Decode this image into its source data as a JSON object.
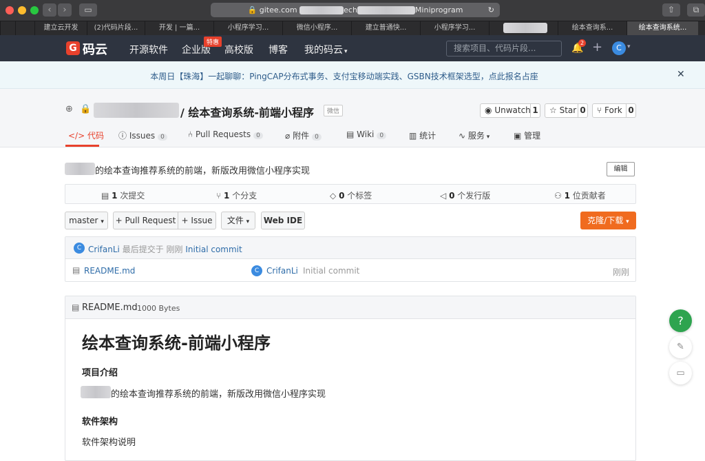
{
  "browser": {
    "url": "gitee.com",
    "url_part2": "ech",
    "url_part3": "Miniprogram",
    "tabs": [
      "建立云开发",
      "(2)代码片段...",
      "开发 | 一篇...",
      "小程序学习...",
      "微信小程序...",
      "建立普通快...",
      "小程序学习...",
      "",
      "绘本查询系...",
      "绘本查询系统..."
    ]
  },
  "header": {
    "logo_mark": "G",
    "logo_text": "码云",
    "nav": [
      "开源软件",
      "企业版",
      "高校版",
      "博客",
      "我的码云"
    ],
    "promo_badge": "特惠",
    "search_placeholder": "搜索项目、代码片段...",
    "notification_count": "2",
    "avatar_letter": "C"
  },
  "announcement": {
    "text": "本周日【珠海】一起聊聊：PingCAP分布式事务、支付宝移动端实践、GSBN技术框架选型，点此报名占座"
  },
  "repo": {
    "title": "/ 绘本查询系统-前端小程序",
    "tag": "微信",
    "watch_label": "Unwatch",
    "watch_count": "1",
    "star_label": "Star",
    "star_count": "0",
    "fork_label": "Fork",
    "fork_count": "0",
    "tabs": [
      {
        "label": "代码",
        "count": ""
      },
      {
        "label": "Issues",
        "count": "0"
      },
      {
        "label": "Pull Requests",
        "count": "0"
      },
      {
        "label": "附件",
        "count": "0"
      },
      {
        "label": "Wiki",
        "count": "0"
      },
      {
        "label": "统计",
        "count": ""
      },
      {
        "label": "服务",
        "count": ""
      },
      {
        "label": "管理",
        "count": ""
      }
    ],
    "description": "的绘本查询推荐系统的前端，新版改用微信小程序实现",
    "edit_label": "编辑"
  },
  "stats": [
    {
      "num": "1",
      "label": "次提交"
    },
    {
      "num": "1",
      "label": "个分支"
    },
    {
      "num": "0",
      "label": "个标签"
    },
    {
      "num": "0",
      "label": "个发行版"
    },
    {
      "num": "1",
      "label": "位贡献者"
    }
  ],
  "toolbar": {
    "branch": "master",
    "pull_request": "+ Pull Request",
    "issue": "+ Issue",
    "files": "文件",
    "web_ide": "Web IDE",
    "clone": "克隆/下载"
  },
  "commit": {
    "author": "CrifanLi",
    "meta": "最后提交于 刚刚",
    "message": "Initial commit",
    "file_name": "README.md",
    "file_author": "CrifanLi",
    "file_message": "Initial commit",
    "file_time": "刚刚"
  },
  "readme": {
    "file": "README.md",
    "size": "1000 Bytes",
    "h1": "绘本查询系统-前端小程序",
    "section1": "项目介绍",
    "intro": "的绘本查询推荐系统的前端，新版改用微信小程序实现",
    "section2": "软件架构",
    "arch": "软件架构说明"
  },
  "float": {
    "help": "?"
  }
}
